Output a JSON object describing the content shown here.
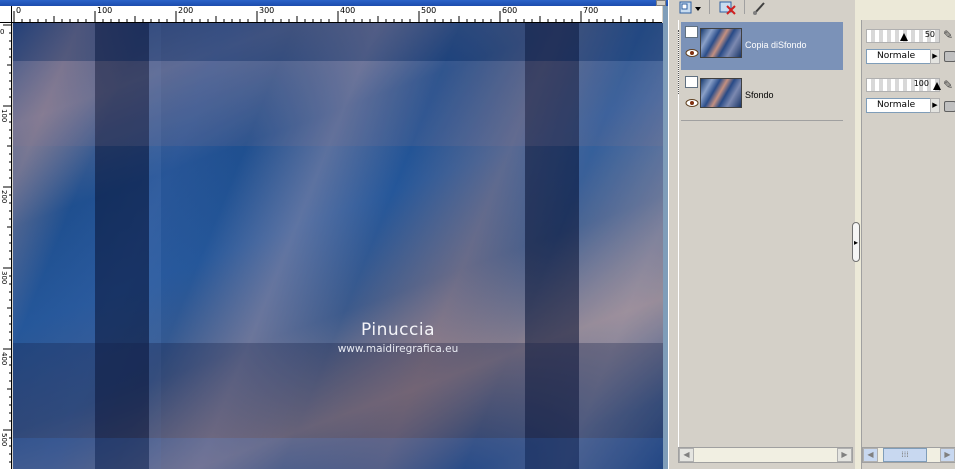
{
  "rulers": {
    "horizontal_labels": [
      "0",
      "100",
      "200",
      "300",
      "400",
      "500",
      "600",
      "700"
    ],
    "vertical_labels": [
      "0",
      "100",
      "200",
      "300",
      "400",
      "500"
    ]
  },
  "canvas": {
    "watermark_title": "Pinuccia",
    "watermark_url": "www.maidiregrafica.eu"
  },
  "layers": {
    "items": [
      {
        "name": "Copia diSfondo",
        "opacity": "50",
        "blend_mode": "Normale",
        "selected": true
      },
      {
        "name": "Sfondo",
        "opacity": "100",
        "blend_mode": "Normale",
        "selected": false
      }
    ]
  },
  "icons": {
    "new_layer": "new-raster-layer-icon",
    "delete_layer": "delete-layer-icon",
    "edit_mask": "brush-icon",
    "visibility": "eye-icon",
    "lock": "lock-icon"
  },
  "colors": {
    "selected_layer_bg": "#7b92b8",
    "panel_bg": "#d4d0c8",
    "canvas_border": "#7f9db9"
  }
}
